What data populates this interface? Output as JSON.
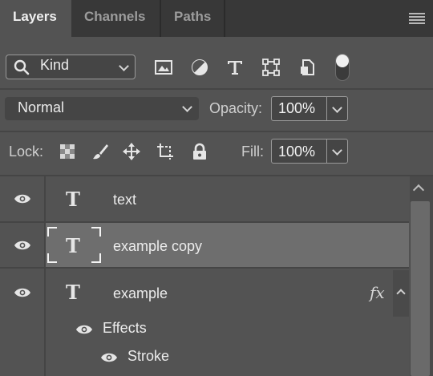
{
  "tabs": [
    {
      "label": "Layers",
      "active": true
    },
    {
      "label": "Channels",
      "active": false
    },
    {
      "label": "Paths",
      "active": false
    }
  ],
  "filter": {
    "kind_label": "Kind",
    "icons": [
      "image-filter-icon",
      "adjustment-filter-icon",
      "type-filter-icon",
      "shape-filter-icon",
      "smart-object-filter-icon"
    ]
  },
  "blend": {
    "mode": "Normal",
    "opacity_label": "Opacity:",
    "opacity_value": "100%"
  },
  "lock": {
    "label": "Lock:",
    "fill_label": "Fill:",
    "fill_value": "100%"
  },
  "layers": [
    {
      "name": "text",
      "type": "text",
      "visible": true,
      "selected": false
    },
    {
      "name": "example copy",
      "type": "text",
      "visible": true,
      "selected": true
    },
    {
      "name": "example",
      "type": "text",
      "visible": true,
      "selected": false,
      "has_effects": true,
      "fx_label": "fx"
    }
  ],
  "effects": {
    "label": "Effects",
    "items": [
      {
        "label": "Stroke"
      }
    ]
  },
  "colors": {
    "panel_bg": "#535353",
    "tabbar_bg": "#383838",
    "selected_row": "#6e6e6e"
  }
}
